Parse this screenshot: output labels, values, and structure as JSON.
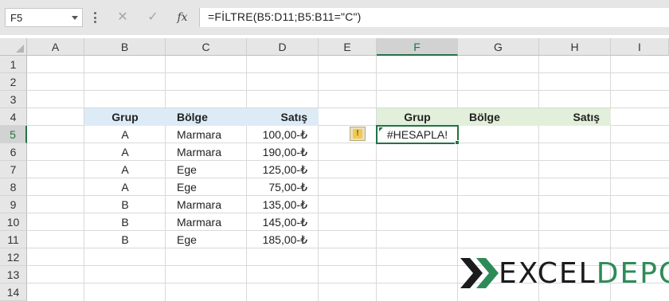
{
  "formula_bar": {
    "name_box": "F5",
    "cancel_icon": "✕",
    "enter_icon": "✓",
    "fx_label": "fx",
    "formula": "=FİLTRE(B5:D11;B5:B11=\"C\")"
  },
  "columns": [
    "A",
    "B",
    "C",
    "D",
    "E",
    "F",
    "G",
    "H",
    "I"
  ],
  "rows": [
    "1",
    "2",
    "3",
    "4",
    "5",
    "6",
    "7",
    "8",
    "9",
    "10",
    "11",
    "12",
    "13",
    "14"
  ],
  "active_cell": {
    "column": "F",
    "row": "5"
  },
  "source_table": {
    "headers": [
      "Grup",
      "Bölge",
      "Satış"
    ],
    "rows": [
      [
        "A",
        "Marmara",
        "100,00-₺"
      ],
      [
        "A",
        "Marmara",
        "190,00-₺"
      ],
      [
        "A",
        "Ege",
        "125,00-₺"
      ],
      [
        "A",
        "Ege",
        "75,00-₺"
      ],
      [
        "B",
        "Marmara",
        "135,00-₺"
      ],
      [
        "B",
        "Marmara",
        "145,00-₺"
      ],
      [
        "B",
        "Ege",
        "185,00-₺"
      ]
    ]
  },
  "result_table": {
    "headers": [
      "Grup",
      "Bölge",
      "Satış"
    ],
    "error_value": "#HESAPLA!",
    "warning_icon_glyph": "!"
  },
  "logo": {
    "part1": "EXCEL",
    "part2": "DEPO",
    "icon": "x-logo-icon"
  },
  "colors": {
    "header_blue": "#ddebf7",
    "header_green": "#e2efda",
    "excel_green": "#217346",
    "logo_green": "#2e8b57"
  }
}
